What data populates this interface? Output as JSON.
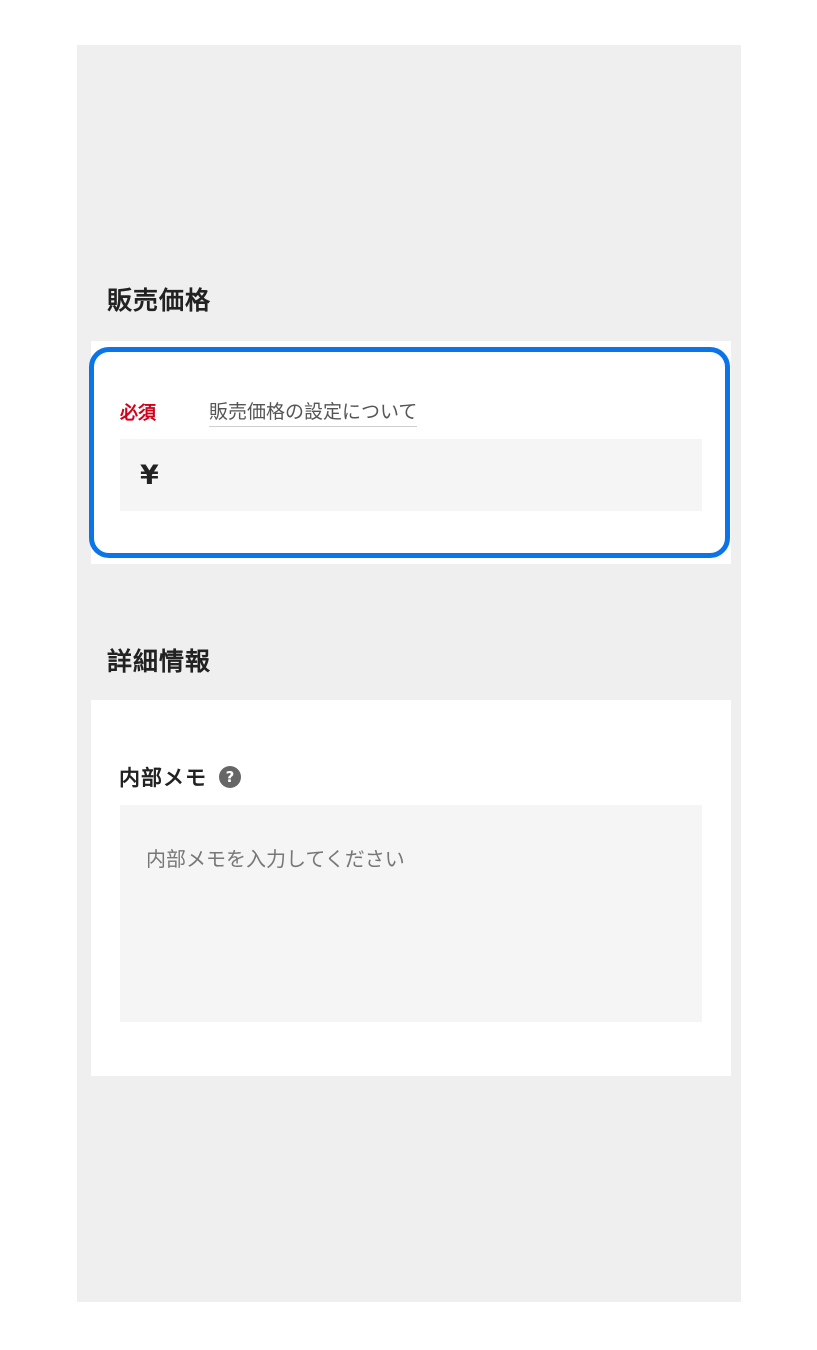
{
  "sections": {
    "price": {
      "title": "販売価格",
      "required_badge": "必須",
      "help_link": "販売価格の設定について",
      "currency_symbol": "¥",
      "price_value": ""
    },
    "detail": {
      "title": "詳細情報",
      "memo_label": "内部メモ",
      "help_icon_glyph": "?",
      "memo_placeholder": "内部メモを入力してください",
      "memo_value": ""
    }
  },
  "colors": {
    "required": "#d0021b",
    "highlight": "#0a74e8",
    "background": "#efefef",
    "input_background": "#f5f5f5"
  },
  "icons": {
    "help": "question-circle-icon",
    "currency": "yen-icon"
  }
}
